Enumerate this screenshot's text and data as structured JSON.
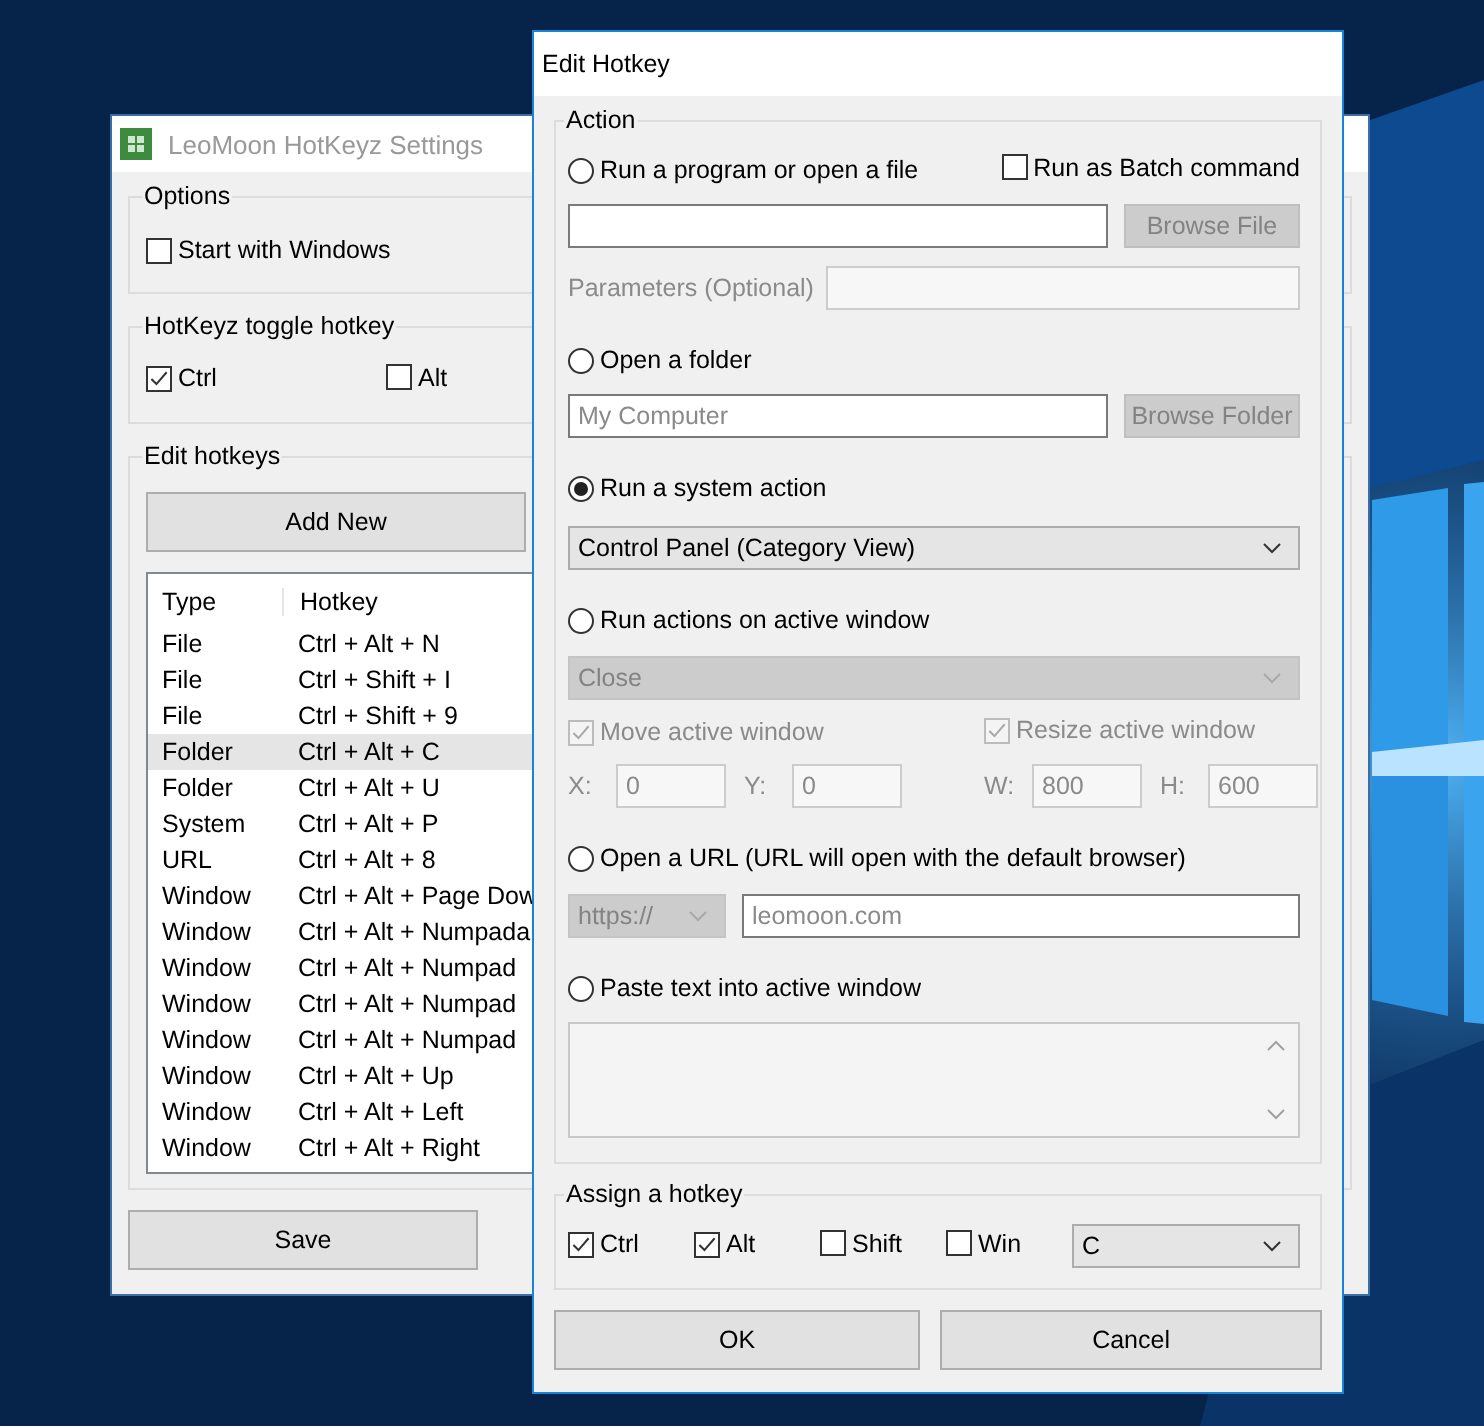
{
  "settings_window": {
    "title": "LeoMoon HotKeyz Settings",
    "options": {
      "label": "Options",
      "start_with_windows": {
        "label": "Start with Windows",
        "checked": false
      }
    },
    "toggle_hotkey": {
      "label": "HotKeyz toggle hotkey",
      "keys": [
        {
          "label": "Ctrl",
          "checked": true
        },
        {
          "label": "Alt",
          "checked": false
        }
      ]
    },
    "edit_hotkeys": {
      "label": "Edit hotkeys",
      "add_button": "Add New",
      "columns": [
        "Type",
        "Hotkey"
      ],
      "rows": [
        {
          "type": "File",
          "hotkey": "Ctrl + Alt + N",
          "selected": false
        },
        {
          "type": "File",
          "hotkey": "Ctrl + Shift + I",
          "selected": false
        },
        {
          "type": "File",
          "hotkey": "Ctrl + Shift + 9",
          "selected": false
        },
        {
          "type": "Folder",
          "hotkey": "Ctrl + Alt + C",
          "selected": true
        },
        {
          "type": "Folder",
          "hotkey": "Ctrl + Alt + U",
          "selected": false
        },
        {
          "type": "System",
          "hotkey": "Ctrl + Alt + P",
          "selected": false
        },
        {
          "type": "URL",
          "hotkey": "Ctrl + Alt + 8",
          "selected": false
        },
        {
          "type": "Window",
          "hotkey": "Ctrl + Alt + Page Dow",
          "selected": false
        },
        {
          "type": "Window",
          "hotkey": "Ctrl + Alt + Numpada",
          "selected": false
        },
        {
          "type": "Window",
          "hotkey": "Ctrl + Alt + Numpad",
          "selected": false
        },
        {
          "type": "Window",
          "hotkey": "Ctrl + Alt + Numpad",
          "selected": false
        },
        {
          "type": "Window",
          "hotkey": "Ctrl + Alt + Numpad",
          "selected": false
        },
        {
          "type": "Window",
          "hotkey": "Ctrl + Alt + Up",
          "selected": false
        },
        {
          "type": "Window",
          "hotkey": "Ctrl + Alt + Left",
          "selected": false
        },
        {
          "type": "Window",
          "hotkey": "Ctrl + Alt + Right",
          "selected": false
        }
      ]
    },
    "save_button": "Save"
  },
  "dialog": {
    "title": "Edit Hotkey",
    "action": {
      "label": "Action",
      "options": [
        {
          "kind": "program",
          "label": "Run a program or open a file",
          "selected": false,
          "batch": {
            "label": "Run as Batch command",
            "checked": false
          },
          "browse": {
            "label": "Browse File",
            "disabled": true
          },
          "parameters": {
            "label": "Parameters (Optional)",
            "disabled": true
          }
        },
        {
          "kind": "folder",
          "label": "Open a folder",
          "selected": false,
          "path": {
            "placeholder": "My Computer"
          },
          "browse": {
            "label": "Browse Folder",
            "disabled": true
          }
        },
        {
          "kind": "system",
          "label": "Run a system action",
          "selected": true,
          "select": {
            "value": "Control Panel (Category View)",
            "disabled": false
          }
        },
        {
          "kind": "window",
          "label": "Run actions on active window",
          "selected": false,
          "select": {
            "value": "Close",
            "disabled": true
          },
          "move": {
            "label": "Move active window",
            "checked": true,
            "disabled": true,
            "fields": [
              {
                "label": "X:",
                "value": "0"
              },
              {
                "label": "Y:",
                "value": "0"
              }
            ]
          },
          "resize": {
            "label": "Resize active window",
            "checked": true,
            "disabled": true,
            "fields": [
              {
                "label": "W:",
                "value": "800"
              },
              {
                "label": "H:",
                "value": "600"
              }
            ]
          }
        },
        {
          "kind": "url",
          "label": "Open a URL (URL will open with the default browser)",
          "selected": false,
          "protocol": {
            "value": "https://",
            "disabled": true
          },
          "address": {
            "placeholder": "leomoon.com"
          }
        },
        {
          "kind": "paste",
          "label": "Paste text into active window",
          "selected": false
        }
      ]
    },
    "assign": {
      "label": "Assign a hotkey",
      "keys": [
        {
          "label": "Ctrl",
          "checked": true
        },
        {
          "label": "Alt",
          "checked": true
        },
        {
          "label": "Shift",
          "checked": false
        },
        {
          "label": "Win",
          "checked": false
        }
      ],
      "key": {
        "value": "C",
        "disabled": false
      }
    },
    "buttons": [
      "OK",
      "Cancel"
    ]
  }
}
